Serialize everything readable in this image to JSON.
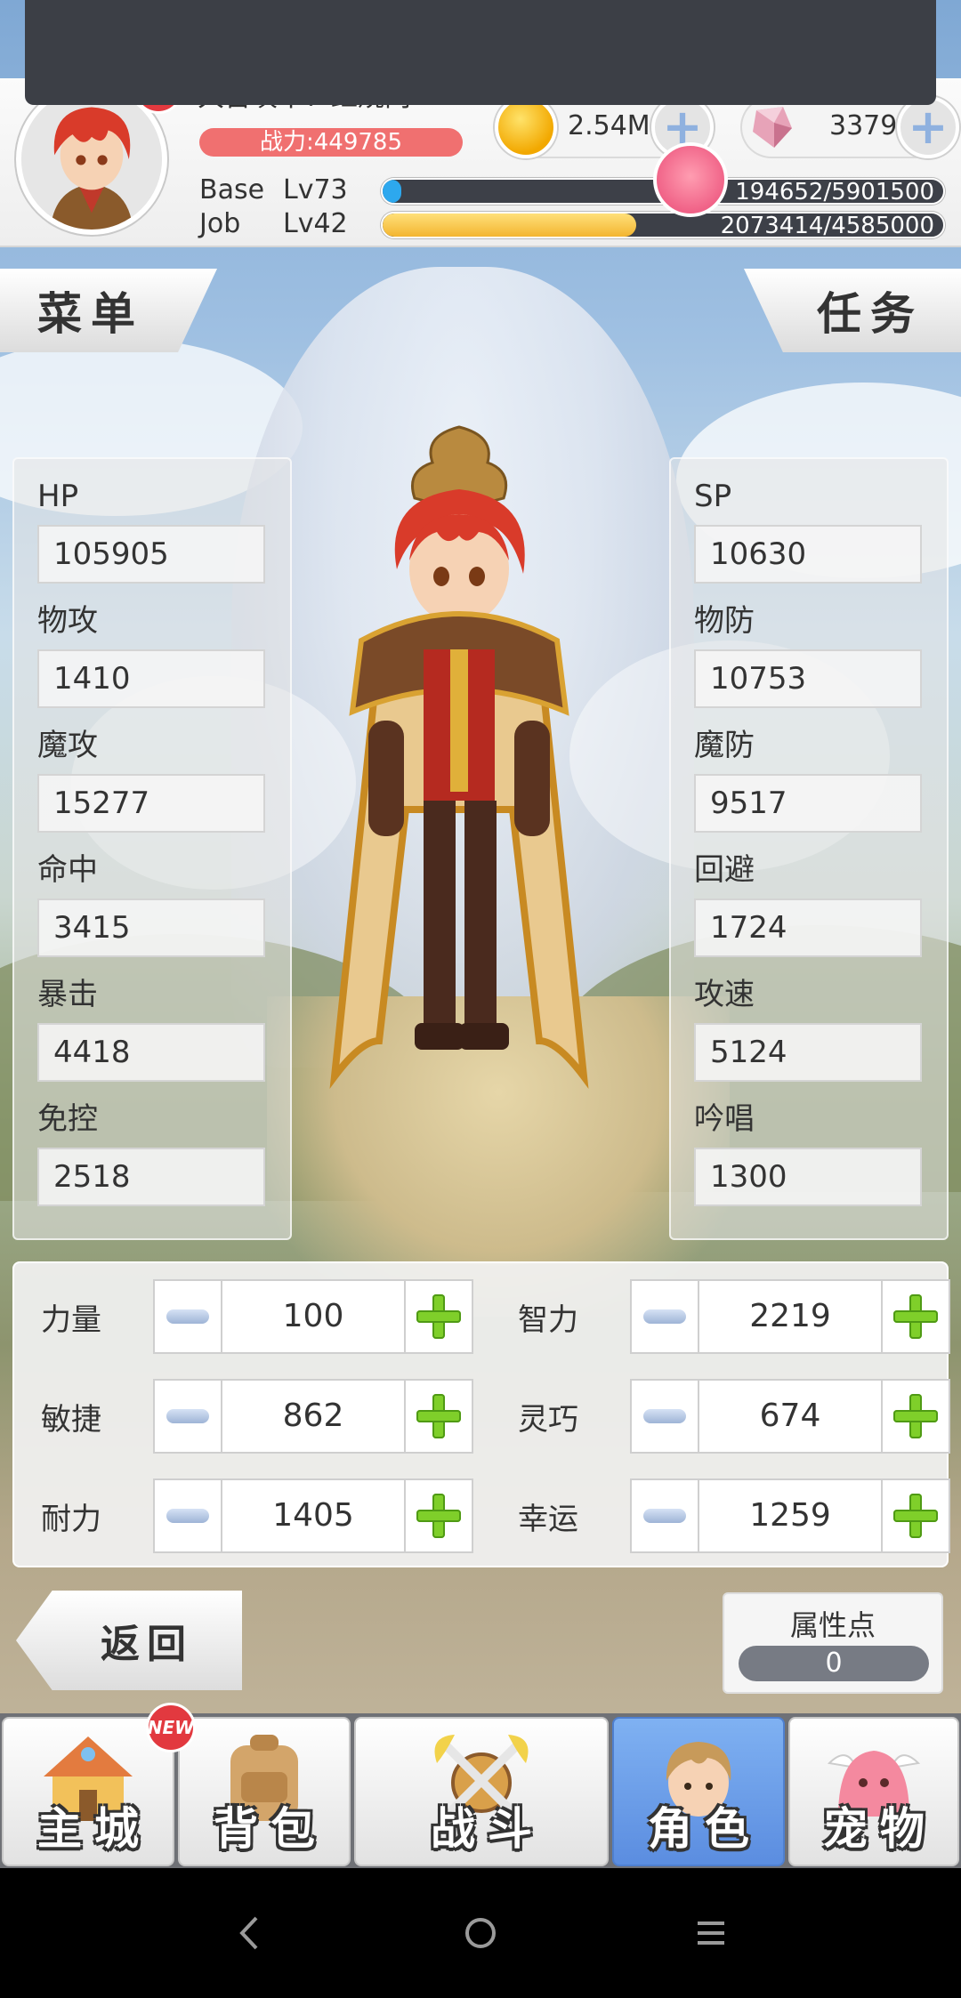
{
  "header": {
    "player_name": "大召唤术：红烧肉",
    "power": "战力:449785",
    "avatar_new_badge": "NEW",
    "zeny": "2.54M",
    "gems": "3379",
    "base_label": "Base",
    "base_level": "Lv73",
    "base_exp": "194652/5901500",
    "base_progress": 0.033,
    "job_label": "Job",
    "job_level": "Lv42",
    "job_exp": "2073414/4585000",
    "job_progress": 0.452
  },
  "buttons": {
    "menu": "菜单",
    "task": "任务",
    "back": "返回"
  },
  "stats_left": [
    {
      "label": "HP",
      "value": "105905"
    },
    {
      "label": "物攻",
      "value": "1410"
    },
    {
      "label": "魔攻",
      "value": "15277"
    },
    {
      "label": "命中",
      "value": "3415"
    },
    {
      "label": "暴击",
      "value": "4418"
    },
    {
      "label": "免控",
      "value": "2518"
    }
  ],
  "stats_right": [
    {
      "label": "SP",
      "value": "10630"
    },
    {
      "label": "物防",
      "value": "10753"
    },
    {
      "label": "魔防",
      "value": "9517"
    },
    {
      "label": "回避",
      "value": "1724"
    },
    {
      "label": "攻速",
      "value": "5124"
    },
    {
      "label": "吟唱",
      "value": "1300"
    }
  ],
  "attributes": [
    {
      "label": "力量",
      "value": "100"
    },
    {
      "label": "智力",
      "value": "2219"
    },
    {
      "label": "敏捷",
      "value": "862"
    },
    {
      "label": "灵巧",
      "value": "674"
    },
    {
      "label": "耐力",
      "value": "1405"
    },
    {
      "label": "幸运",
      "value": "1259"
    }
  ],
  "points": {
    "label": "属性点",
    "value": "0"
  },
  "tabs": [
    {
      "label": "主城",
      "badge": "NEW",
      "active": false
    },
    {
      "label": "背包",
      "active": false
    },
    {
      "label": "战斗",
      "active": false
    },
    {
      "label": "角色",
      "active": true
    },
    {
      "label": "宠物",
      "active": false
    }
  ],
  "colors": {
    "accent_blue": "#5b8de0",
    "power_pill": "#f07070",
    "plus_green": "#7fcf2a"
  }
}
